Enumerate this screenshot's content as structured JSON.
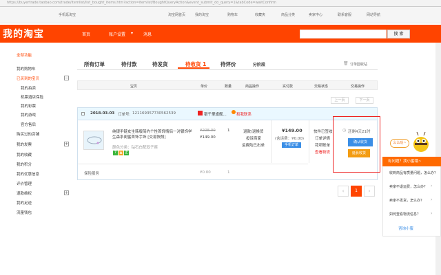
{
  "browser": {
    "url": "https://buyertrade.taobao.com/trade/itemlist/list_bought_items.htm?action=itemlist/BoughtQueryAction&event_submit_do_query=1&tabCode=waitConfirm"
  },
  "topbar": {
    "left_link": "手机逛淘宝",
    "links": [
      "淘宝网首页",
      "我的淘宝",
      "购物车",
      "收藏夹",
      "商品分类",
      "卖家中心",
      "联系客服",
      "网站导航"
    ]
  },
  "header": {
    "logo": "我的淘宝",
    "nav": [
      "首页",
      "账户设置",
      "消息"
    ],
    "search_button": "搜 索"
  },
  "sidebar": {
    "items": [
      {
        "label": "全部功能",
        "head": true
      },
      {
        "label": "我的购物车"
      },
      {
        "label": "已买到的宝贝",
        "head": true,
        "expand": true
      },
      {
        "label": "我的拍卖"
      },
      {
        "label": "机票酒店保险"
      },
      {
        "label": "我的彩票"
      },
      {
        "label": "我的游戏"
      },
      {
        "label": "官方售后"
      },
      {
        "label": "购买过的店铺"
      },
      {
        "label": "我的发票",
        "expand": true
      },
      {
        "label": "我的收藏"
      },
      {
        "label": "我的积分"
      },
      {
        "label": "我的优惠信息"
      },
      {
        "label": "评价管理"
      },
      {
        "label": "退款维权",
        "expand": true
      },
      {
        "label": "我的足迹"
      },
      {
        "label": "流量钱包"
      }
    ]
  },
  "tabs": [
    "所有订单",
    "待付款",
    "待发货",
    "待收货 1",
    "待评价",
    "分阶段"
  ],
  "recycle_label": "订单回收站",
  "table_headers": [
    "宝贝",
    "单价",
    "数量",
    "商品操作",
    "实付款",
    "交易状态",
    "交易操作"
  ],
  "pager_small": {
    "prev": "上一页",
    "next": "下一页"
  },
  "order": {
    "date": "2018-03-03",
    "order_no_label": "订单号:",
    "order_no": "121169357730562539",
    "shop": "银千里旗舰...",
    "chat": "和我联系",
    "title": "纯银手链女生韩版简约个性首饰情侣一对银饰学生森系闺蜜首饰手饰 [交易快照]",
    "sku": "颜色分类：钻石白配双子座",
    "orig_price": "¥208.00",
    "price": "¥149.00",
    "qty": "1",
    "ops": [
      "退款/退换货",
      "投诉商家",
      "运费险已出单"
    ],
    "paid": "¥149.00",
    "paid_note": "(含运费：¥0.00)",
    "pay_tag": "手机订单",
    "status": [
      "快件已签收",
      "订单详情",
      "查看物流"
    ],
    "status_extra": "花呗账单",
    "remain": "还剩4天21时",
    "confirm": "确认收货",
    "delay": "延长收货",
    "service_label": "保险服务",
    "service_price": "¥0.00",
    "service_qty": "1"
  },
  "page": {
    "current": "1"
  },
  "helper": {
    "bubble": "么么哒~",
    "title": "有问题？找小蜜哦~",
    "questions": [
      "收到商品有质量问题，怎么办？",
      "卖家不退运费，怎么办？",
      "卖家不发货，怎么办？",
      "如何查看物流信息？"
    ],
    "footer": "咨询小蜜"
  },
  "colors": {
    "brand": "#ff4400",
    "confirm": "#3a8ee6",
    "delay": "#f39c12",
    "highlight_border": "#e22222"
  }
}
